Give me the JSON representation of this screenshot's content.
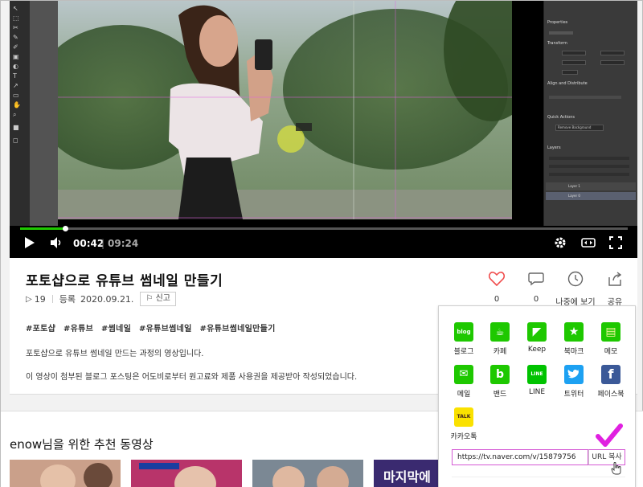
{
  "player": {
    "time_current": "00:42",
    "time_separator": "|",
    "time_total": "09:24",
    "progress": 0.074,
    "ps_panel_titles": [
      "Properties",
      "Transform",
      "Align and Distribute",
      "Quick Actions",
      "Layers"
    ],
    "ps_button_label": "Remove Background",
    "ps_layer_names": [
      "Layer 1",
      "Layer 0"
    ]
  },
  "video": {
    "title": "포토샵으로 유튜브 썸네일 만들기",
    "view_count": "19",
    "registered_label": "등록",
    "registered_date": "2020.09.21.",
    "report_label": "신고",
    "hashtags": [
      "#포토샵",
      "#유튜브",
      "#썸네일",
      "#유튜브썸네일",
      "#유튜브썸네일만들기"
    ],
    "description_line1": "포토샵으로 유튜브 썸네일 만드는 과정의 영상입니다.",
    "description_line2": "이 영상이 첨부된 블로그 포스팅은 어도비로부터 원고료와 제품 사용권을 제공받아 작성되었습니다."
  },
  "actions": {
    "like_count": "0",
    "comment_count": "0",
    "watch_later_label": "나중에 보기",
    "share_label": "공유"
  },
  "share": {
    "items": [
      {
        "label": "블로그",
        "icon": "blog-icon",
        "glyph": "blog",
        "color": "#1ec800"
      },
      {
        "label": "카페",
        "icon": "cafe-icon",
        "glyph": "☕",
        "color": "#1ec800"
      },
      {
        "label": "Keep",
        "icon": "keep-icon",
        "glyph": "◤",
        "color": "#1ec800"
      },
      {
        "label": "북마크",
        "icon": "bookmark-icon",
        "glyph": "★",
        "color": "#1ec800"
      },
      {
        "label": "메모",
        "icon": "memo-icon",
        "glyph": "▤",
        "color": "#1ec800"
      },
      {
        "label": "메일",
        "icon": "mail-icon",
        "glyph": "✉",
        "color": "#1ec800"
      },
      {
        "label": "밴드",
        "icon": "band-icon",
        "glyph": "b",
        "color": "#1ec800"
      },
      {
        "label": "LINE",
        "icon": "line-icon",
        "glyph": "LINE",
        "color": "#00c300"
      },
      {
        "label": "트위터",
        "icon": "twitter-icon",
        "glyph": "🐦",
        "color": "#1da1f2"
      },
      {
        "label": "페이스북",
        "icon": "facebook-icon",
        "glyph": "f",
        "color": "#3b5998"
      },
      {
        "label": "카카오톡",
        "icon": "kakaotalk-icon",
        "glyph": "TALK",
        "color": "#fae100"
      }
    ],
    "url": "https://tv.naver.com/v/15879756",
    "copy_label": "URL 복사"
  },
  "recommend": {
    "title": "enow님을 위한 추천 동영상",
    "thumb_banner_text": "마지막에"
  },
  "colors": {
    "accent_green": "#1ec800",
    "highlight_magenta": "#e020e0",
    "like_red": "#f04e4e"
  }
}
